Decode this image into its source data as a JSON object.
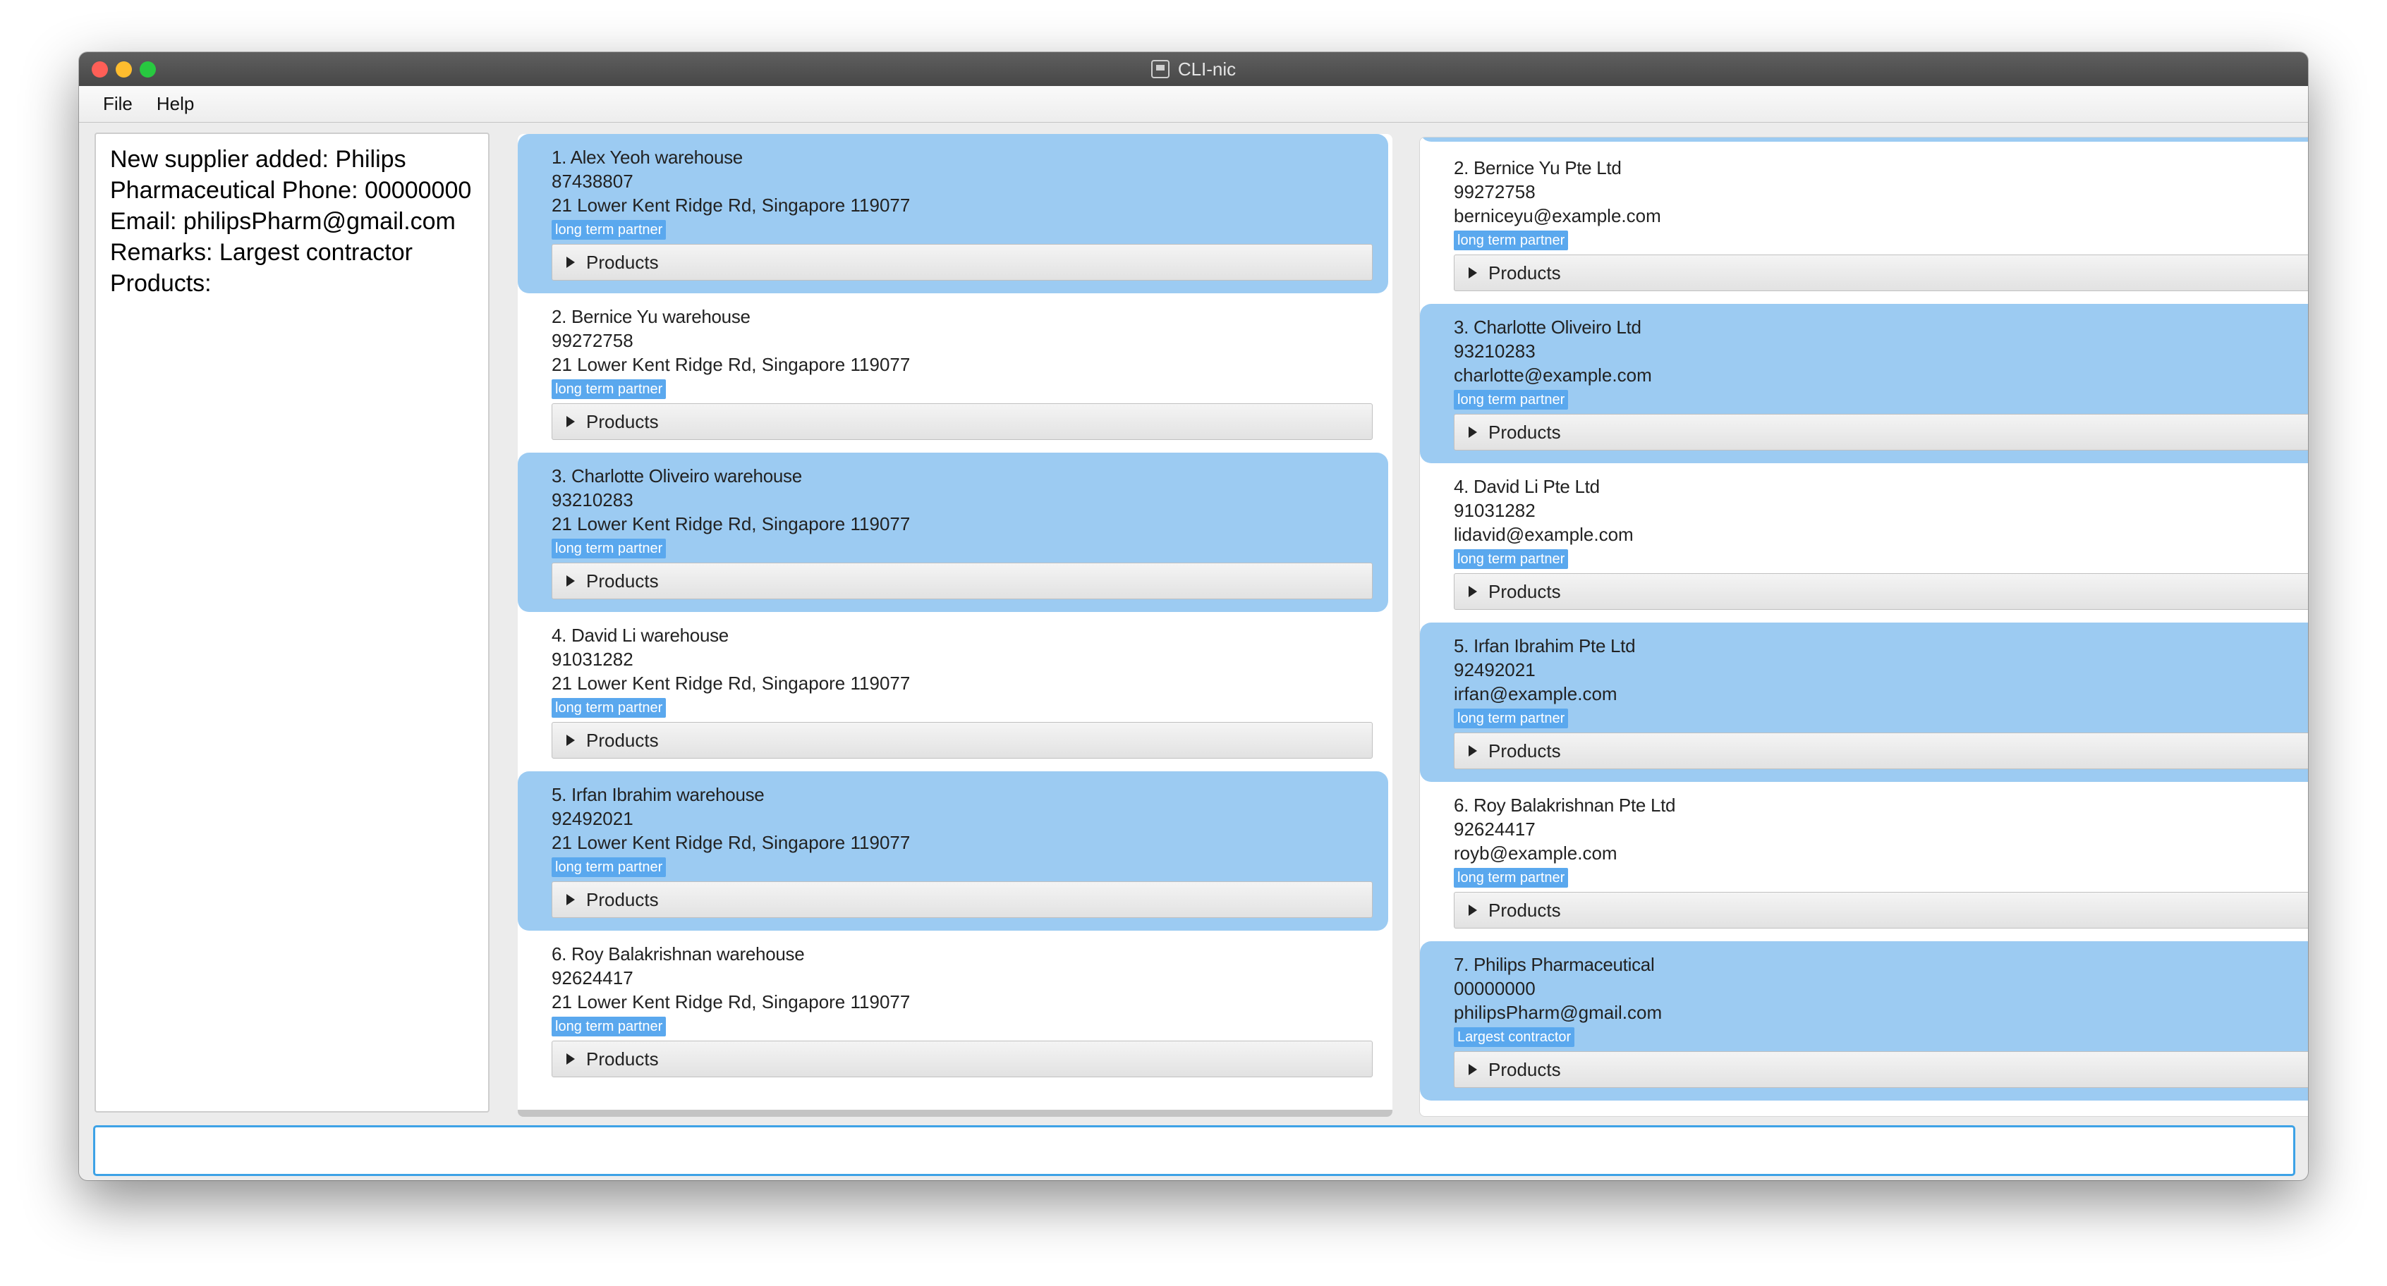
{
  "window": {
    "title": "CLI-nic"
  },
  "menu": {
    "file": "File",
    "help": "Help"
  },
  "result_display": {
    "text": "New supplier added: Philips\nPharmaceutical Phone: 00000000\nEmail: philipsPharm@gmail.com\nRemarks: Largest contractor\nProducts:"
  },
  "warehouses": [
    {
      "name": "1.  Alex Yeoh warehouse",
      "phone": "87438807",
      "address": "21 Lower Kent Ridge Rd, Singapore 119077",
      "tag": "long term partner",
      "products_label": "Products"
    },
    {
      "name": "2.  Bernice Yu warehouse",
      "phone": "99272758",
      "address": "21 Lower Kent Ridge Rd, Singapore 119077",
      "tag": "long term partner",
      "products_label": "Products"
    },
    {
      "name": "3.  Charlotte Oliveiro warehouse",
      "phone": "93210283",
      "address": "21 Lower Kent Ridge Rd, Singapore 119077",
      "tag": "long term partner",
      "products_label": "Products"
    },
    {
      "name": "4.  David Li warehouse",
      "phone": "91031282",
      "address": "21 Lower Kent Ridge Rd, Singapore 119077",
      "tag": "long term partner",
      "products_label": "Products"
    },
    {
      "name": "5.  Irfan Ibrahim warehouse",
      "phone": "92492021",
      "address": "21 Lower Kent Ridge Rd, Singapore 119077",
      "tag": "long term partner",
      "products_label": "Products"
    },
    {
      "name": "6.  Roy Balakrishnan warehouse",
      "phone": "92624417",
      "address": "21 Lower Kent Ridge Rd, Singapore 119077",
      "tag": "long term partner",
      "products_label": "Products"
    }
  ],
  "suppliers": [
    {
      "name": "2.  Bernice Yu Pte Ltd",
      "phone": "99272758",
      "email": "berniceyu@example.com",
      "tag": "long term partner",
      "products_label": "Products"
    },
    {
      "name": "3.  Charlotte Oliveiro Ltd",
      "phone": "93210283",
      "email": "charlotte@example.com",
      "tag": "long term partner",
      "products_label": "Products"
    },
    {
      "name": "4.  David Li Pte Ltd",
      "phone": "91031282",
      "email": "lidavid@example.com",
      "tag": "long term partner",
      "products_label": "Products"
    },
    {
      "name": "5.  Irfan Ibrahim Pte Ltd",
      "phone": "92492021",
      "email": "irfan@example.com",
      "tag": "long term partner",
      "products_label": "Products"
    },
    {
      "name": "6.  Roy Balakrishnan Pte Ltd",
      "phone": "92624417",
      "email": "royb@example.com",
      "tag": "long term partner",
      "products_label": "Products"
    },
    {
      "name": "7.  Philips Pharmaceutical",
      "phone": "00000000",
      "email": "philipsPharm@gmail.com",
      "tag": "Largest contractor",
      "products_label": "Products"
    }
  ],
  "command_box": {
    "value": ""
  },
  "colors": {
    "card_highlight": "#9ccbf2",
    "tag": "#5aa8ee",
    "command_border": "#3da2e6"
  }
}
